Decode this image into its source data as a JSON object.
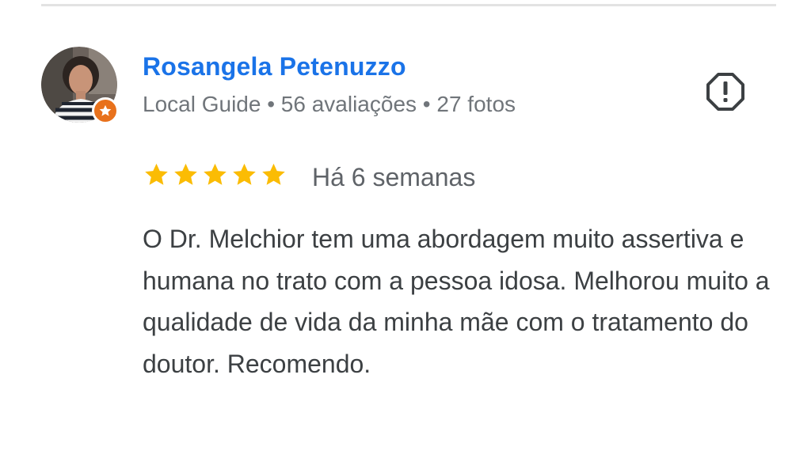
{
  "review": {
    "reviewer": {
      "name": "Rosangela Petenuzzo",
      "meta": "Local Guide • 56 avaliações • 27 fotos",
      "badge_icon": "local-guide-star-icon",
      "badge_color": "#e8711c"
    },
    "rating": {
      "stars": 5,
      "max": 5,
      "color": "#fbbc04"
    },
    "date": "Há 6 semanas",
    "text": "O Dr. Melchior tem uma abordagem muito assertiva e humana no trato com a pessoa idosa. Melhorou muito a qualidade de vida da minha mãe com o tratamento do doutor. Recomendo.",
    "report_icon": "report-octagon-icon"
  },
  "colors": {
    "name": "#1a73e8",
    "meta": "#70757a",
    "text": "#3c4043",
    "divider": "#e3e3e3"
  }
}
